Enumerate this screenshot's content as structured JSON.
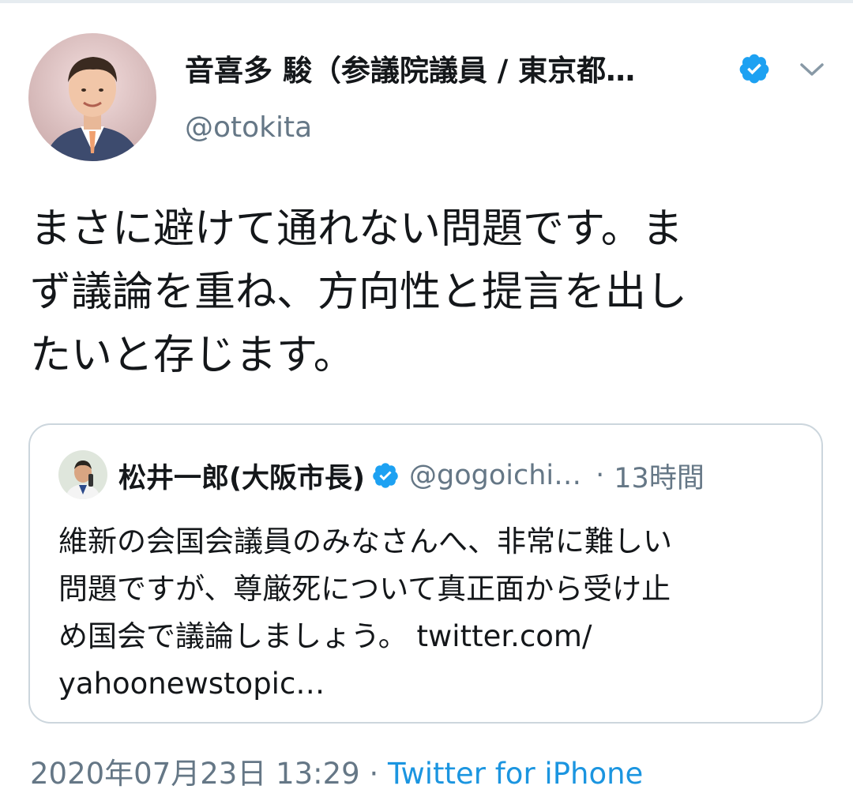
{
  "tweet": {
    "author_name": "音喜多 駿（参議院議員 / 東京都…",
    "handle": "@otokita",
    "text": "まさに避けて通れない問題です。ま\nず議論を重ね、方向性と提言を出し\nたいと存じます。",
    "timestamp": "2020年07月23日 13:29",
    "separator": "·",
    "source": "Twitter for iPhone"
  },
  "quoted": {
    "author_name": "松井一郎(大阪市長)",
    "handle": "@gogoichi…",
    "separator": "·",
    "time": "13時間",
    "text": "維新の会国会議員のみなさんへ、非常に難しい\n問題ですが、尊厳死について真正面から受け止\nめ国会で議論しましょう。 twitter.com/\nyahoonewstopic…"
  },
  "icons": {
    "verified": "verified-badge-icon",
    "menu": "chevron-down-icon"
  },
  "colors": {
    "text": "#14171a",
    "secondary": "#657786",
    "link": "#1b95e0",
    "verified": "#1da1f2",
    "border": "#ccd6dd"
  }
}
